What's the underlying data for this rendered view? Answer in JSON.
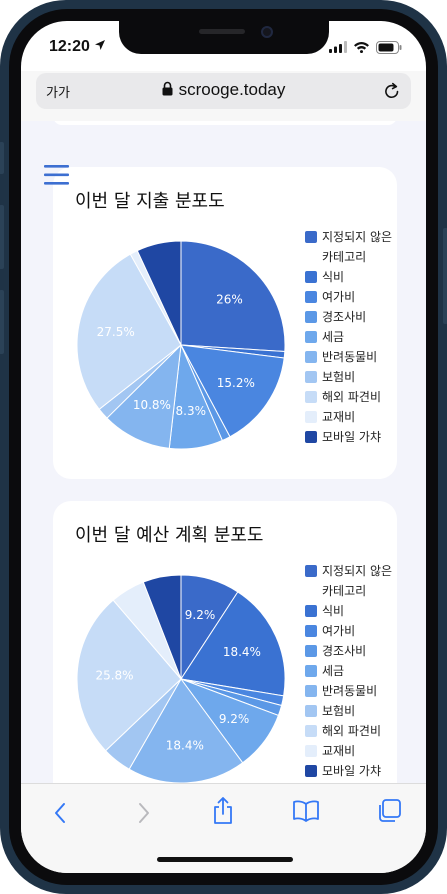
{
  "status_bar": {
    "time": "12:20"
  },
  "browser": {
    "text_size_label": "가가",
    "url": "scrooge.today"
  },
  "colors": {
    "accent": "#3d6fd1",
    "page_bg": "#f3f4fb",
    "categories": [
      "#3a6ac9",
      "#3a72d2",
      "#4a86e0",
      "#5b98e6",
      "#6ea8ec",
      "#84b5ef",
      "#a2c6f2",
      "#c6dcf7",
      "#e4eefb",
      "#1f47a3"
    ]
  },
  "legend": [
    "지정되지 않은 카테고리",
    "식비",
    "여가비",
    "경조사비",
    "세금",
    "반려동물비",
    "보험비",
    "해외 파견비",
    "교재비",
    "모바일 가챠"
  ],
  "chart_data": [
    {
      "type": "pie",
      "title": "이번 달 지출 분포도",
      "categories": [
        "지정되지 않은 카테고리",
        "식비",
        "여가비",
        "경조사비",
        "세금",
        "반려동물비",
        "보험비",
        "해외 파견비",
        "교재비",
        "모바일 가챠"
      ],
      "values": [
        26,
        1,
        15.2,
        1.3,
        8.3,
        10.8,
        1.8,
        27.5,
        1.2,
        6.9
      ],
      "labels": [
        "26%",
        "",
        "15.2%",
        "",
        "8.3%",
        "10.8%",
        "",
        "27.5%",
        "",
        ""
      ]
    },
    {
      "type": "pie",
      "title": "이번 달 예산 계획 분포도",
      "categories": [
        "지정되지 않은 카테고리",
        "식비",
        "여가비",
        "경조사비",
        "세금",
        "반려동물비",
        "보험비",
        "해외 파견비",
        "교재비",
        "모바일 가챠"
      ],
      "values": [
        9.2,
        18.4,
        1.5,
        1.6,
        9.2,
        18.4,
        4.6,
        25.8,
        5.4,
        5.9
      ],
      "labels": [
        "9.2%",
        "18.4%",
        "",
        "",
        "9.2%",
        "18.4%",
        "",
        "25.8%",
        "",
        ""
      ]
    }
  ]
}
